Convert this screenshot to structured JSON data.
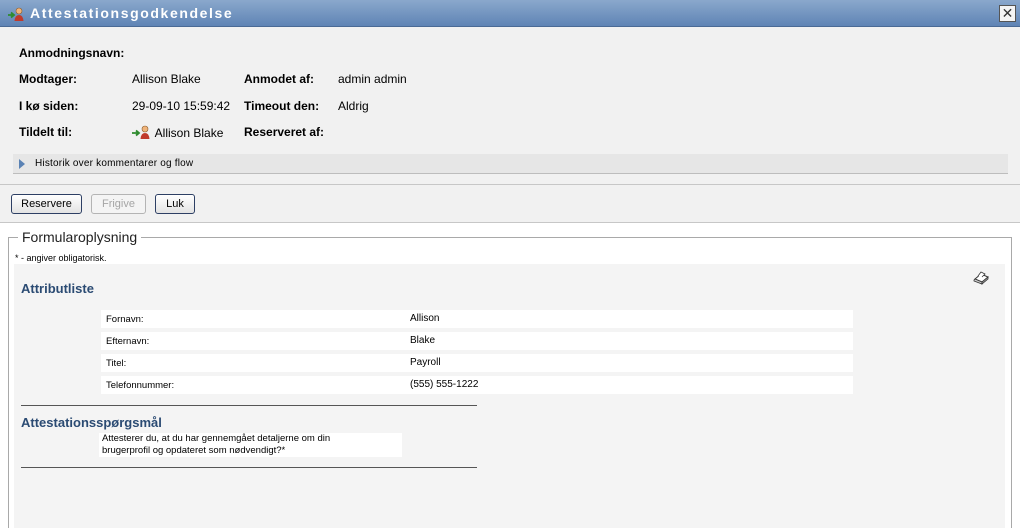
{
  "window": {
    "title": "Attestationsgodkendelse",
    "close_glyph": "✕",
    "title_icon": "user-forward-icon"
  },
  "header": {
    "request_name_label": "Anmodningsnavn:",
    "recipient_label": "Modtager:",
    "recipient_value": "Allison Blake",
    "requested_by_label": "Anmodet af:",
    "requested_by_value": "admin admin",
    "queued_since_label": "I kø siden:",
    "queued_since_value": "29-09-10 15:59:42",
    "timeout_label": "Timeout den:",
    "timeout_value": "Aldrig",
    "assigned_to_label": "Tildelt til:",
    "assigned_to_value": "Allison Blake",
    "reserved_by_label": "Reserveret af:",
    "history_label": "Historik over kommentarer og flow"
  },
  "buttons": {
    "reserve": "Reservere",
    "release": "Frigive",
    "close": "Luk"
  },
  "form": {
    "legend": "Formularoplysning",
    "required_note": "* - angiver obligatorisk.",
    "attributes_title": "Attributliste",
    "attributes": [
      {
        "label": "Fornavn:",
        "value": "Allison"
      },
      {
        "label": "Efternavn:",
        "value": "Blake"
      },
      {
        "label": "Titel:",
        "value": "Payroll"
      },
      {
        "label": "Telefonnummer:",
        "value": "(555) 555-1222"
      }
    ],
    "questions_title": "Attestationsspørgsmål",
    "question_line1": "Attesterer du, at du har gennemgået detaljerne om din",
    "question_line2": "brugerprofil og opdateret som nødvendigt?*"
  },
  "colors": {
    "titlebar": "#6f91bf",
    "section_title": "#2b4b73"
  }
}
